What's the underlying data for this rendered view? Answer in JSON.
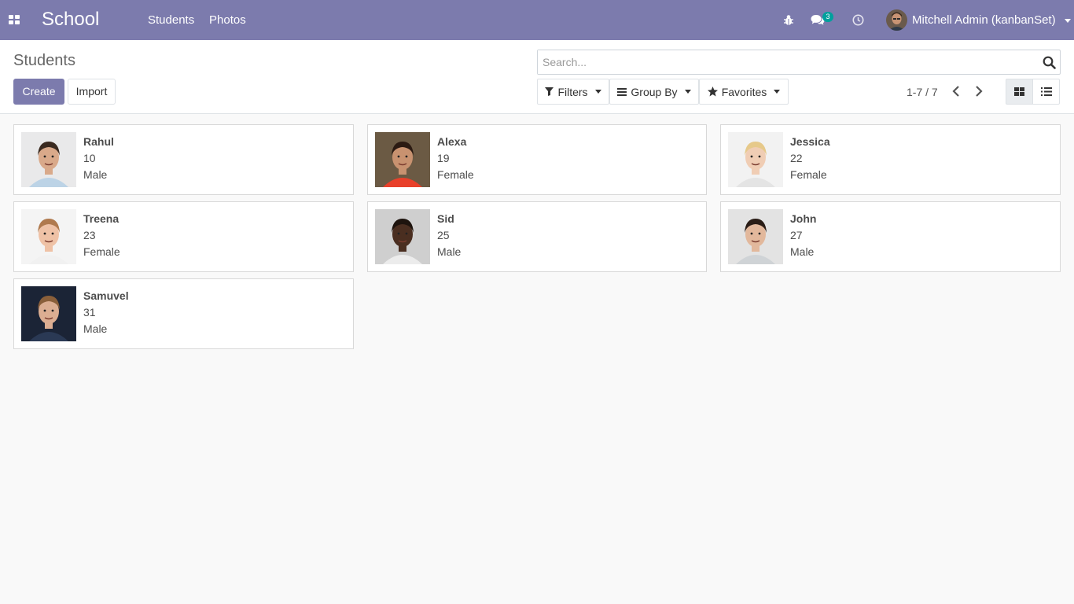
{
  "navbar": {
    "brand": "School",
    "menu": [
      "Students",
      "Photos"
    ],
    "message_count": "3",
    "user": "Mitchell Admin (kanbanSet)"
  },
  "control_panel": {
    "title": "Students",
    "create_label": "Create",
    "import_label": "Import",
    "search_placeholder": "Search...",
    "filters_label": "Filters",
    "groupby_label": "Group By",
    "favorites_label": "Favorites",
    "pager": "1-7 / 7"
  },
  "students": [
    {
      "name": "Rahul",
      "age": "10",
      "gender": "Male",
      "bg": "#e9e9ea",
      "skin": "#d9a98a",
      "hair": "#3a2a20",
      "shirt": "#bcd3e6"
    },
    {
      "name": "Alexa",
      "age": "19",
      "gender": "Female",
      "bg": "#6b5a44",
      "skin": "#c89270",
      "hair": "#2b1a12",
      "shirt": "#e8402a"
    },
    {
      "name": "Jessica",
      "age": "22",
      "gender": "Female",
      "bg": "#f2f2f2",
      "skin": "#f0cdb4",
      "hair": "#e6c98a",
      "shirt": "#e4e4e4"
    },
    {
      "name": "Treena",
      "age": "23",
      "gender": "Female",
      "bg": "#f4f4f4",
      "skin": "#efc2a6",
      "hair": "#b07a4e",
      "shirt": "#f1f1f1"
    },
    {
      "name": "Sid",
      "age": "25",
      "gender": "Male",
      "bg": "#cfcfcf",
      "skin": "#4a2e20",
      "hair": "#1e140e",
      "shirt": "#ececec"
    },
    {
      "name": "John",
      "age": "27",
      "gender": "Male",
      "bg": "#e3e3e3",
      "skin": "#e2b89c",
      "hair": "#2a1d16",
      "shirt": "#cfd3d6"
    },
    {
      "name": "Samuvel",
      "age": "31",
      "gender": "Male",
      "bg": "#1b2436",
      "skin": "#dcae92",
      "hair": "#8a5f3a",
      "shirt": "#2a3954"
    }
  ],
  "colors": {
    "navbar": "#7c7bad",
    "primary": "#7c7bad",
    "badge": "#00a09d"
  }
}
